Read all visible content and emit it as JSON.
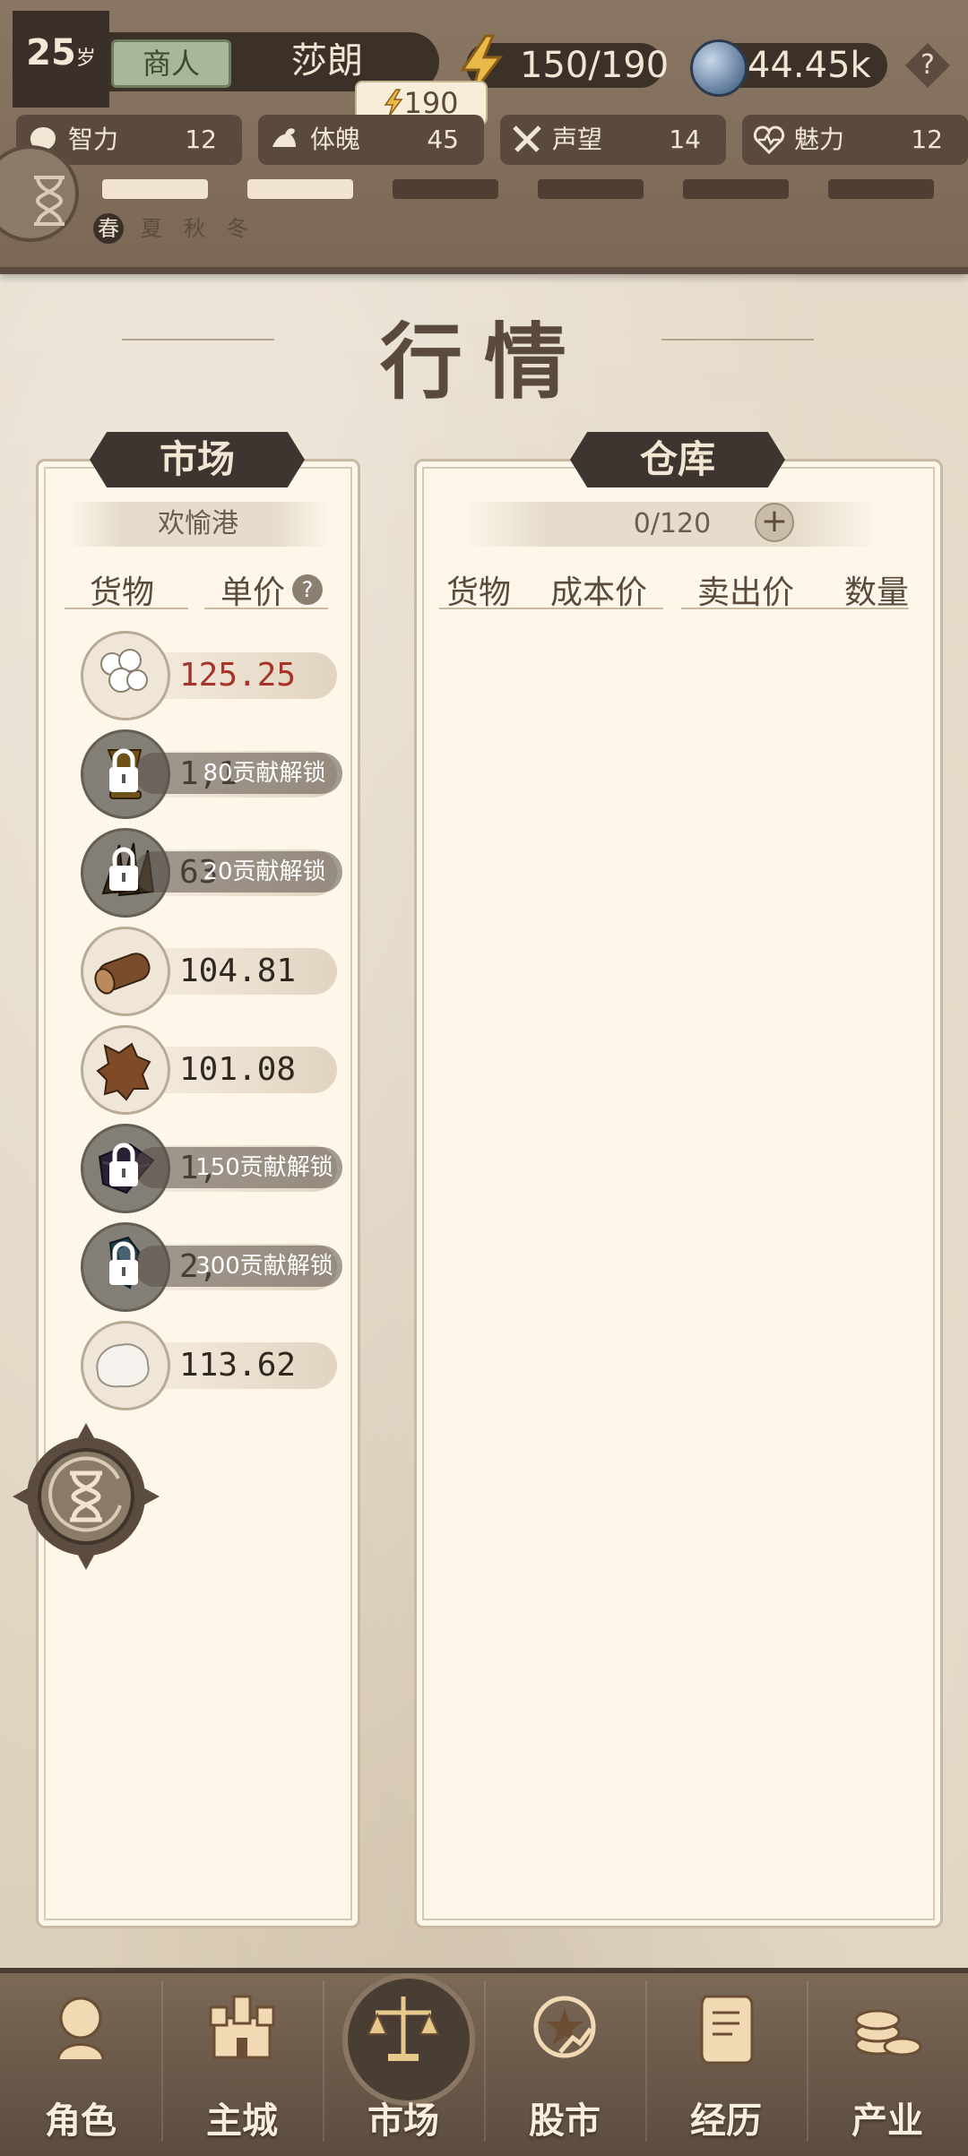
{
  "header": {
    "age": "25",
    "age_unit": "岁",
    "role": "商人",
    "name": "莎朗",
    "energy": "150/190",
    "energy_tip": "190",
    "coins": "44.45k",
    "help": "?",
    "stats": [
      {
        "label": "智力",
        "value": "12",
        "icon": "brain-icon"
      },
      {
        "label": "体魄",
        "value": "45",
        "icon": "muscle-icon"
      },
      {
        "label": "声望",
        "value": "14",
        "icon": "crossed-swords-icon"
      },
      {
        "label": "魅力",
        "value": "12",
        "icon": "heart-icon"
      }
    ],
    "progress_filled": 2,
    "progress_total": 6,
    "seasons": [
      "春",
      "夏",
      "秋",
      "冬"
    ],
    "active_season": 0
  },
  "title": "行情",
  "market": {
    "tag": "市场",
    "location": "欢愉港",
    "col_goods": "货物",
    "col_price": "单价",
    "help": "?",
    "items": [
      {
        "icon": "cotton-icon",
        "price": "125.25",
        "price_color": "#a8332a",
        "locked": false
      },
      {
        "icon": "golden-goblet-icon",
        "price": "1,1",
        "locked": true,
        "lock_text": "80贡献解锁"
      },
      {
        "icon": "spices-icon",
        "price": "63",
        "locked": true,
        "lock_text": "20贡献解锁"
      },
      {
        "icon": "wood-log-icon",
        "price": "104.81",
        "locked": false
      },
      {
        "icon": "leather-hide-icon",
        "price": "101.08",
        "locked": false
      },
      {
        "icon": "silk-cloth-icon",
        "price": "1,",
        "locked": true,
        "lock_text": "150贡献解锁"
      },
      {
        "icon": "gemstone-icon",
        "price": "2,",
        "locked": true,
        "lock_text": "300贡献解锁"
      },
      {
        "icon": "salt-rock-icon",
        "price": "113.62",
        "locked": false
      }
    ]
  },
  "warehouse": {
    "tag": "仓库",
    "capacity": "0/120",
    "cols": [
      "货物",
      "成本价",
      "卖出价",
      "数量"
    ]
  },
  "nav": [
    {
      "label": "角色",
      "icon": "character-icon"
    },
    {
      "label": "主城",
      "icon": "castle-icon"
    },
    {
      "label": "市场",
      "icon": "scales-icon"
    },
    {
      "label": "股市",
      "icon": "stock-market-icon"
    },
    {
      "label": "经历",
      "icon": "scroll-icon"
    },
    {
      "label": "产业",
      "icon": "coins-icon"
    }
  ],
  "colors": {
    "header_bg": "#7a6855",
    "dark_panel": "#3c3129",
    "parchment": "#fdf6e9",
    "progress_filled": "#f0e4ce",
    "progress_empty": "#4f3f33",
    "red_price": "#a8332a"
  }
}
